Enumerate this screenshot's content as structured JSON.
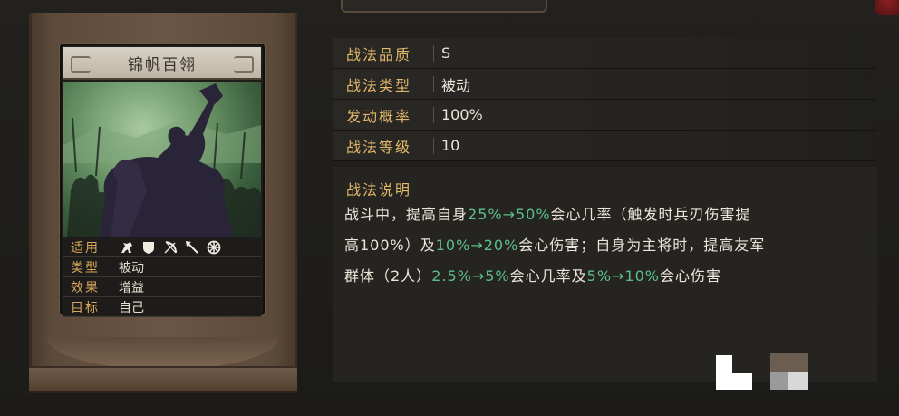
{
  "skill_card": {
    "name": "锦帆百翎",
    "info": [
      {
        "label": "适用",
        "value": ""
      },
      {
        "label": "类型",
        "value": "被动"
      },
      {
        "label": "效果",
        "value": "增益"
      },
      {
        "label": "目标",
        "value": "自己"
      }
    ],
    "applicable_units": [
      "cavalry-icon",
      "shield-icon",
      "archer-icon",
      "spear-icon",
      "siege-icon"
    ]
  },
  "attributes": [
    {
      "label": "战法品质",
      "value": "S"
    },
    {
      "label": "战法类型",
      "value": "被动"
    },
    {
      "label": "发动概率",
      "value": "100%"
    },
    {
      "label": "战法等级",
      "value": "10"
    }
  ],
  "description": {
    "title": "战法说明",
    "line1": {
      "a": "战斗中，提高自身",
      "b": "25%→50%",
      "c": "会心几率（触发时兵刃伤害提"
    },
    "line2": {
      "a": "高100%）及",
      "b": "10%→20%",
      "c": "会心伤害；自身为主将时，提高友军"
    },
    "line3": {
      "a": "群体（2人）",
      "b": "2.5%→5%",
      "c": "会心几率及",
      "d": "5%→10%",
      "e": "会心伤害"
    }
  },
  "colors": {
    "label_gold": "#e0b86a",
    "highlight_green": "#5bbf8a",
    "card_label": "#d9a85a",
    "background": "#1b1a18"
  }
}
